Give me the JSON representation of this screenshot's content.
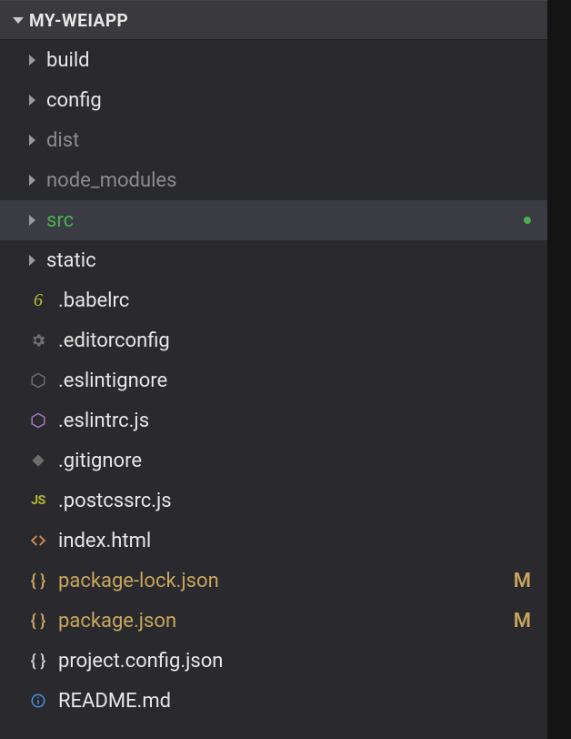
{
  "explorer": {
    "header": "MY-WEIAPP",
    "entries": [
      {
        "type": "folder",
        "label": "build",
        "color": "clr-white",
        "selected": false,
        "icon": "twisty-right"
      },
      {
        "type": "folder",
        "label": "config",
        "color": "clr-white",
        "selected": false,
        "icon": "twisty-right"
      },
      {
        "type": "folder",
        "label": "dist",
        "color": "clr-dim",
        "selected": false,
        "icon": "twisty-right"
      },
      {
        "type": "folder",
        "label": "node_modules",
        "color": "clr-dim",
        "selected": false,
        "icon": "twisty-right"
      },
      {
        "type": "folder",
        "label": "src",
        "color": "clr-green",
        "selected": true,
        "icon": "twisty-right",
        "statusDot": true
      },
      {
        "type": "folder",
        "label": "static",
        "color": "clr-white",
        "selected": false,
        "icon": "twisty-right"
      },
      {
        "type": "file",
        "label": ".babelrc",
        "color": "clr-white",
        "icon": "six-icon"
      },
      {
        "type": "file",
        "label": ".editorconfig",
        "color": "clr-white",
        "icon": "gear-icon"
      },
      {
        "type": "file",
        "label": ".eslintignore",
        "color": "clr-white",
        "icon": "hex-dim-icon"
      },
      {
        "type": "file",
        "label": ".eslintrc.js",
        "color": "clr-white",
        "icon": "hex-purple-icon"
      },
      {
        "type": "file",
        "label": ".gitignore",
        "color": "clr-white",
        "icon": "diamond-icon"
      },
      {
        "type": "file",
        "label": ".postcssrc.js",
        "color": "clr-white",
        "icon": "js-icon"
      },
      {
        "type": "file",
        "label": "index.html",
        "color": "clr-white",
        "icon": "angle-brackets-icon"
      },
      {
        "type": "file",
        "label": "package-lock.json",
        "color": "clr-yellow",
        "icon": "braces-icon",
        "statusLetter": "M"
      },
      {
        "type": "file",
        "label": "package.json",
        "color": "clr-yellow",
        "icon": "braces-icon",
        "statusLetter": "M"
      },
      {
        "type": "file",
        "label": "project.config.json",
        "color": "clr-white",
        "icon": "braces-white-icon"
      },
      {
        "type": "file",
        "label": "README.md",
        "color": "clr-white",
        "icon": "info-icon"
      }
    ]
  }
}
